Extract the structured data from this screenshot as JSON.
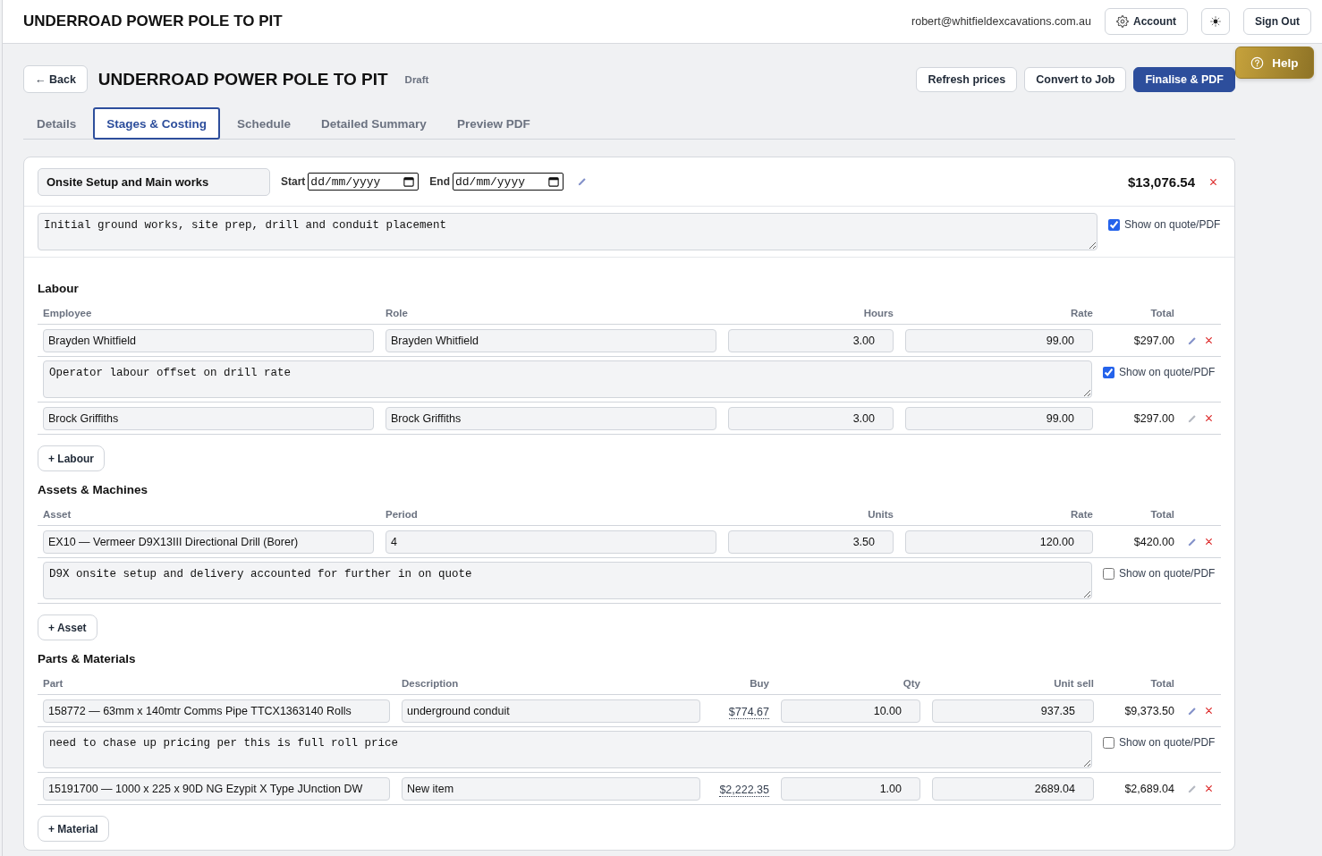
{
  "top_bar": {
    "title": "UNDERROAD POWER POLE TO PIT",
    "email": "robert@whitfieldexcavations.com.au",
    "account_button": {
      "label": "Account"
    },
    "sign_out_button": {
      "label": "Sign Out"
    }
  },
  "help_button": {
    "label": "Help"
  },
  "header": {
    "back_button": {
      "label": "← Back"
    },
    "title": "UNDERROAD POWER POLE TO PIT",
    "status": "Draft",
    "actions": [
      {
        "label": "Refresh prices",
        "kind": "secondary"
      },
      {
        "label": "Convert to Job",
        "kind": "secondary"
      },
      {
        "label": "Finalise & PDF",
        "kind": "primary"
      }
    ]
  },
  "tabs": [
    {
      "label": "Details",
      "selected": false
    },
    {
      "label": "Stages & Costing",
      "selected": true
    },
    {
      "label": "Schedule",
      "selected": false
    },
    {
      "label": "Detailed Summary",
      "selected": false
    },
    {
      "label": "Preview PDF",
      "selected": false
    }
  ],
  "stage": {
    "name": "Onsite Setup and Main works",
    "start": {
      "label": "Start",
      "placeholder": "dd/mm/yyyy"
    },
    "end": {
      "label": "End",
      "placeholder": "dd/mm/yyyy"
    },
    "total": "$13,076.54",
    "description": "Initial ground works, site prep, drill and conduit placement",
    "show_on_quote": {
      "label": "Show on quote/PDF",
      "checked": true
    },
    "sections": [
      {
        "kind": "labour",
        "title": "Labour",
        "columns": [
          {
            "label": "Employee",
            "kind": "text"
          },
          {
            "label": "Role",
            "kind": "text"
          },
          {
            "label": "Hours",
            "kind": "number"
          },
          {
            "label": "Rate",
            "kind": "number"
          },
          {
            "label": "Total",
            "kind": "total"
          }
        ],
        "rows": [
          {
            "cells": [
              "Brayden Whitfield",
              "Brayden Whitfield",
              "3.00",
              "99.00",
              "$297.00"
            ],
            "note": {
              "text": "Operator labour offset on drill rate",
              "show_on_quote": {
                "label": "Show on quote/PDF",
                "checked": true
              }
            }
          },
          {
            "cells": [
              "Brock Griffiths",
              "Brock Griffiths",
              "3.00",
              "99.00",
              "$297.00"
            ]
          }
        ],
        "add_button": "+ Labour"
      },
      {
        "kind": "assets",
        "title": "Assets & Machines",
        "columns": [
          {
            "label": "Asset",
            "kind": "text"
          },
          {
            "label": "Period",
            "kind": "text"
          },
          {
            "label": "Units",
            "kind": "number"
          },
          {
            "label": "Rate",
            "kind": "number"
          },
          {
            "label": "Total",
            "kind": "total"
          }
        ],
        "rows": [
          {
            "cells": [
              "EX10 — Vermeer D9X13III Directional Drill (Borer)",
              "4",
              "3.50",
              "120.00",
              "$420.00"
            ],
            "note": {
              "text": "D9X onsite setup and delivery accounted for further in on quote",
              "show_on_quote": {
                "label": "Show on quote/PDF",
                "checked": false
              }
            }
          }
        ],
        "add_button": "+ Asset"
      },
      {
        "kind": "materials",
        "title": "Parts & Materials",
        "columns": [
          {
            "label": "Part",
            "kind": "text"
          },
          {
            "label": "Description",
            "kind": "text"
          },
          {
            "label": "Buy",
            "kind": "price"
          },
          {
            "label": "Qty",
            "kind": "number"
          },
          {
            "label": "Unit sell",
            "kind": "number"
          },
          {
            "label": "Total",
            "kind": "total"
          }
        ],
        "rows": [
          {
            "cells": [
              "158772 — 63mm x 140mtr Comms Pipe TTCX1363140 Rolls",
              "underground conduit",
              "$774.67",
              "10.00",
              "937.35",
              "$9,373.50"
            ],
            "note": {
              "text": "need to chase up pricing per this is full roll price",
              "show_on_quote": {
                "label": "Show on quote/PDF",
                "checked": false
              }
            }
          },
          {
            "cells": [
              "15191700 — 1000 x 225 x 90D NG Ezypit X Type JUnction DW",
              "New item",
              "$2,222.35",
              "1.00",
              "2689.04",
              "$2,689.04"
            ]
          }
        ],
        "add_button": "+ Material"
      }
    ]
  }
}
